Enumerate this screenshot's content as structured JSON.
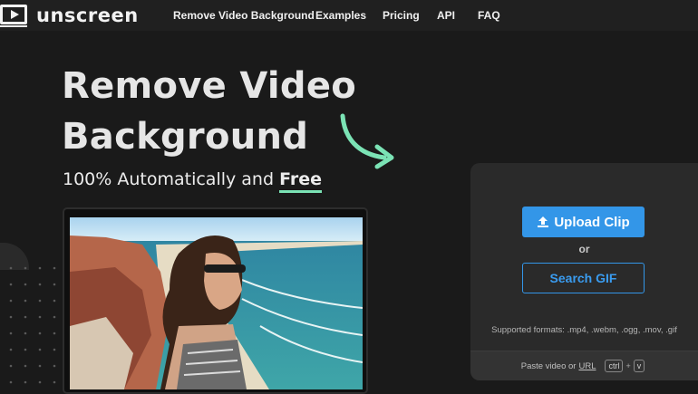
{
  "nav": {
    "logo_text": "unscreen",
    "links": [
      "Remove Video Background",
      "Examples",
      "Pricing",
      "API",
      "FAQ"
    ]
  },
  "hero": {
    "title_line1": "Remove Video",
    "title_line2": "Background",
    "subtitle_prefix": "100% Automatically and ",
    "subtitle_emphasis": "Free"
  },
  "upload_panel": {
    "upload_label": "Upload Clip",
    "or_label": "or",
    "search_label": "Search GIF",
    "formats": "Supported formats: .mp4, .webm, .ogg, .mov, .gif",
    "paste_prefix": "Paste video or",
    "paste_link": "URL",
    "key1": "ctrl",
    "plus": "+",
    "key2": "v"
  },
  "colors": {
    "background": "#1a1a1a",
    "accent_blue": "#3396e8",
    "accent_green": "#7be3b5"
  },
  "icons": {
    "logo": "play-screen-icon",
    "upload": "upload-icon",
    "arrow": "curved-arrow-icon"
  }
}
